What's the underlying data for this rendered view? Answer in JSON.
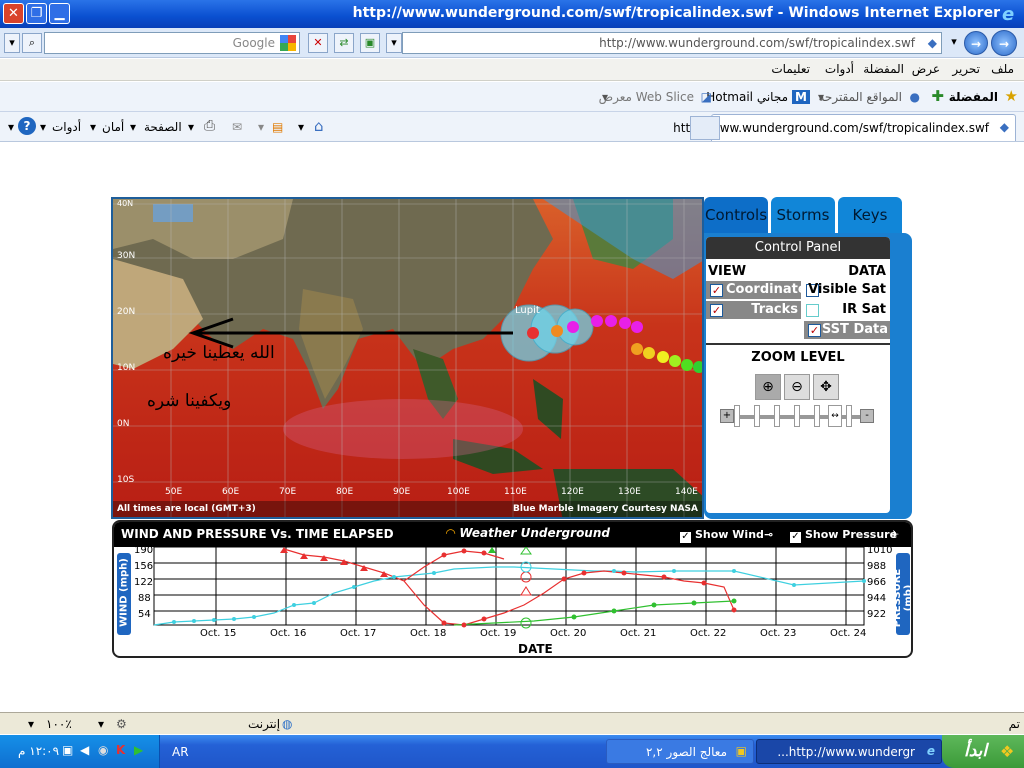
{
  "window": {
    "title": "http://www.wunderground.com/swf/tropicalindex.swf - Windows Internet Explorer"
  },
  "addressbar": {
    "url": "http://www.wunderground.com/swf/tropicalindex.swf",
    "search_placeholder": "Google"
  },
  "menubar": {
    "items": [
      "ملف",
      "تحرير",
      "عرض",
      "المفضلة",
      "أدوات",
      "تعليمات"
    ]
  },
  "favorites": {
    "label": "المفضلة",
    "items": [
      "المواقع المقترحة",
      "Hotmail مجاني",
      "معرض Web Slice"
    ]
  },
  "tabbar": {
    "tab_title": "http://www.wunderground.com/swf/tropicalindex.swf"
  },
  "commandbar": {
    "page": "الصفحة",
    "safety": "أمان",
    "tools": "أدوات"
  },
  "map": {
    "storm_name": "Lupit",
    "overlay_text_1": "الله يعطينا خيره",
    "overlay_text_2": "ويكفينا شره",
    "lat_labels": [
      "40N",
      "30N",
      "20N",
      "10N",
      "0N",
      "10S"
    ],
    "lon_labels": [
      "50E",
      "60E",
      "70E",
      "80E",
      "90E",
      "100E",
      "110E",
      "120E",
      "130E",
      "140E"
    ],
    "footer_left": "All times are local (GMT+3)",
    "footer_right": "Blue Marble Imagery Courtesy NASA"
  },
  "control_panel": {
    "tabs": [
      "Controls",
      "Storms",
      "Keys"
    ],
    "title": "Control Panel",
    "view_label": "VIEW",
    "data_label": "DATA",
    "view_options": [
      {
        "label": "Coordinates",
        "checked": true
      },
      {
        "label": "Tracks",
        "checked": true
      }
    ],
    "data_options": [
      {
        "label": "Visible Sat",
        "checked": false
      },
      {
        "label": "IR Sat",
        "checked": false
      },
      {
        "label": "SST Data",
        "checked": true
      }
    ],
    "zoom_label": "ZOOM LEVEL"
  },
  "graph": {
    "title": "WIND AND PRESSURE Vs. TIME ELAPSED",
    "brand": "Weather Underground",
    "show_wind": "Show Wind",
    "show_pressure": "Show Pressure",
    "wind_axis": "WIND (mph)",
    "pressure_axis": "PRESSURE (mb)",
    "x_axis": "DATE",
    "wind_ticks": [
      "190",
      "156",
      "122",
      "88",
      "54"
    ],
    "pressure_ticks": [
      "1010",
      "988",
      "966",
      "944",
      "922"
    ],
    "dates": [
      "Oct. 15",
      "Oct. 16",
      "Oct. 17",
      "Oct. 18",
      "Oct. 19",
      "Oct. 20",
      "Oct. 21",
      "Oct. 22",
      "Oct. 23",
      "Oct. 24"
    ]
  },
  "statusbar": {
    "left": "تم",
    "zone": "إنترنت",
    "zoom": "١٠٠٪"
  },
  "taskbar": {
    "start": "ابدأ",
    "tasks": [
      "...http://www.wundergr",
      "معالج الصور ٢,٢"
    ],
    "clock": "١٢:٠٩ م",
    "lang": "AR"
  }
}
